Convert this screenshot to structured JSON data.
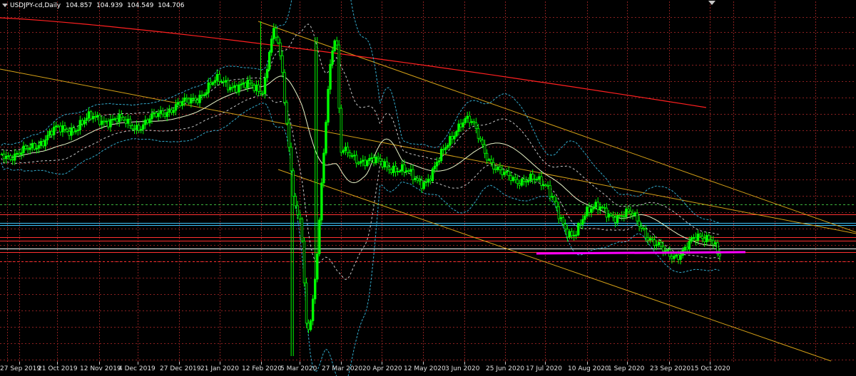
{
  "window": {
    "title": "USDJPY-cd,Daily",
    "ohlc": {
      "open": "104.857",
      "high": "104.939",
      "low": "104.549",
      "close": "104.706"
    }
  },
  "colors": {
    "background": "#000000",
    "bull_candle": "#00ff00",
    "channel": "#d4a017",
    "moving_average_long": "#ff2020",
    "moving_average_short": "#e8f4c8",
    "bands_outer": "#33aacc",
    "bands_inner": "#c8c8c8",
    "support_line": "#ff00ff",
    "horizontal_red": "#ff3030",
    "horizontal_cyan": "#40c8ff",
    "horizontal_green": "#3cb43c",
    "grid": "#8a2020"
  },
  "icons": {
    "title_arrow": "triangle-down-icon",
    "corner_arrow": "triangle-down-icon"
  },
  "chart_data": {
    "type": "candlestick",
    "symbol": "USDJPY-cd",
    "timeframe": "Daily",
    "x_tick_labels": [
      "27 Sep 2019",
      "21 Oct 2019",
      "12 Nov 2019",
      "4 Dec 2019",
      "27 Dec 2019",
      "21 Jan 2020",
      "12 Feb 2020",
      "5 Mar 2020",
      "27 Mar 2020",
      "20 Apr 2020",
      "12 May 2020",
      "3 Jun 2020",
      "25 Jun 2020",
      "17 Jul 2020",
      "10 Aug 2020",
      "1 Sep 2020",
      "23 Sep 2020",
      "15 Oct 2020"
    ],
    "approx_close": [
      [
        "27 Sep 2019",
        107.9
      ],
      [
        "21 Oct 2019",
        108.6
      ],
      [
        "12 Nov 2019",
        109.0
      ],
      [
        "4 Dec 2019",
        108.8
      ],
      [
        "27 Dec 2019",
        109.4
      ],
      [
        "21 Jan 2020",
        110.1
      ],
      [
        "12 Feb 2020",
        109.9
      ],
      [
        "19 Feb 2020",
        111.6
      ],
      [
        "5 Mar 2020",
        106.0
      ],
      [
        "9 Mar 2020",
        102.4
      ],
      [
        "24 Mar 2020",
        111.5
      ],
      [
        "27 Mar 2020",
        107.9
      ],
      [
        "20 Apr 2020",
        107.6
      ],
      [
        "12 May 2020",
        107.1
      ],
      [
        "3 Jun 2020",
        108.9
      ],
      [
        "25 Jun 2020",
        107.2
      ],
      [
        "17 Jul 2020",
        107.0
      ],
      [
        "31 Jul 2020",
        105.3
      ],
      [
        "10 Aug 2020",
        106.2
      ],
      [
        "1 Sep 2020",
        106.0
      ],
      [
        "23 Sep 2020",
        104.8
      ],
      [
        "15 Oct 2020",
        105.4
      ],
      [
        "21 Oct 2020",
        104.7
      ]
    ],
    "ylim": [
      101.5,
      112.6
    ],
    "legend": "none",
    "grid": true
  }
}
